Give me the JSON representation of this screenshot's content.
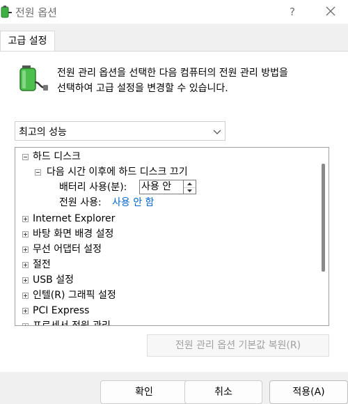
{
  "window": {
    "title": "전원 옵션",
    "help": "?"
  },
  "tab": {
    "label": "고급 설정"
  },
  "description": {
    "line1": "전원 관리 옵션을 선택한 다음 컴퓨터의 전원 관리 방법을",
    "line2": "선택하여 고급 설정을 변경할 수 있습니다."
  },
  "plan": {
    "selected": "최고의 성능"
  },
  "tree": {
    "hard_disk": "하드 디스크",
    "turn_off_after": "다음 시간 이후에 하드 디스크 끄기",
    "on_battery_label": "배터리 사용(분):",
    "on_battery_value": "사용 안 함",
    "plugged_in_label": "전원 사용:",
    "plugged_in_value": "사용 안 함",
    "items": [
      "Internet Explorer",
      "바탕 화면 배경 설정",
      "무선 어댑터 설정",
      "절전",
      "USB 설정",
      "인텔(R) 그래픽 설정",
      "PCI Express",
      "프로세서 전원 관리"
    ]
  },
  "buttons": {
    "restore": "전원 관리 옵션 기본값 복원(R)",
    "ok": "확인",
    "cancel": "취소",
    "apply": "적용(A)"
  },
  "icons": {
    "app": "power-options-icon",
    "battery": "battery-plug-icon"
  },
  "colors": {
    "link": "#0066cc",
    "accent_green": "#3cb043"
  }
}
